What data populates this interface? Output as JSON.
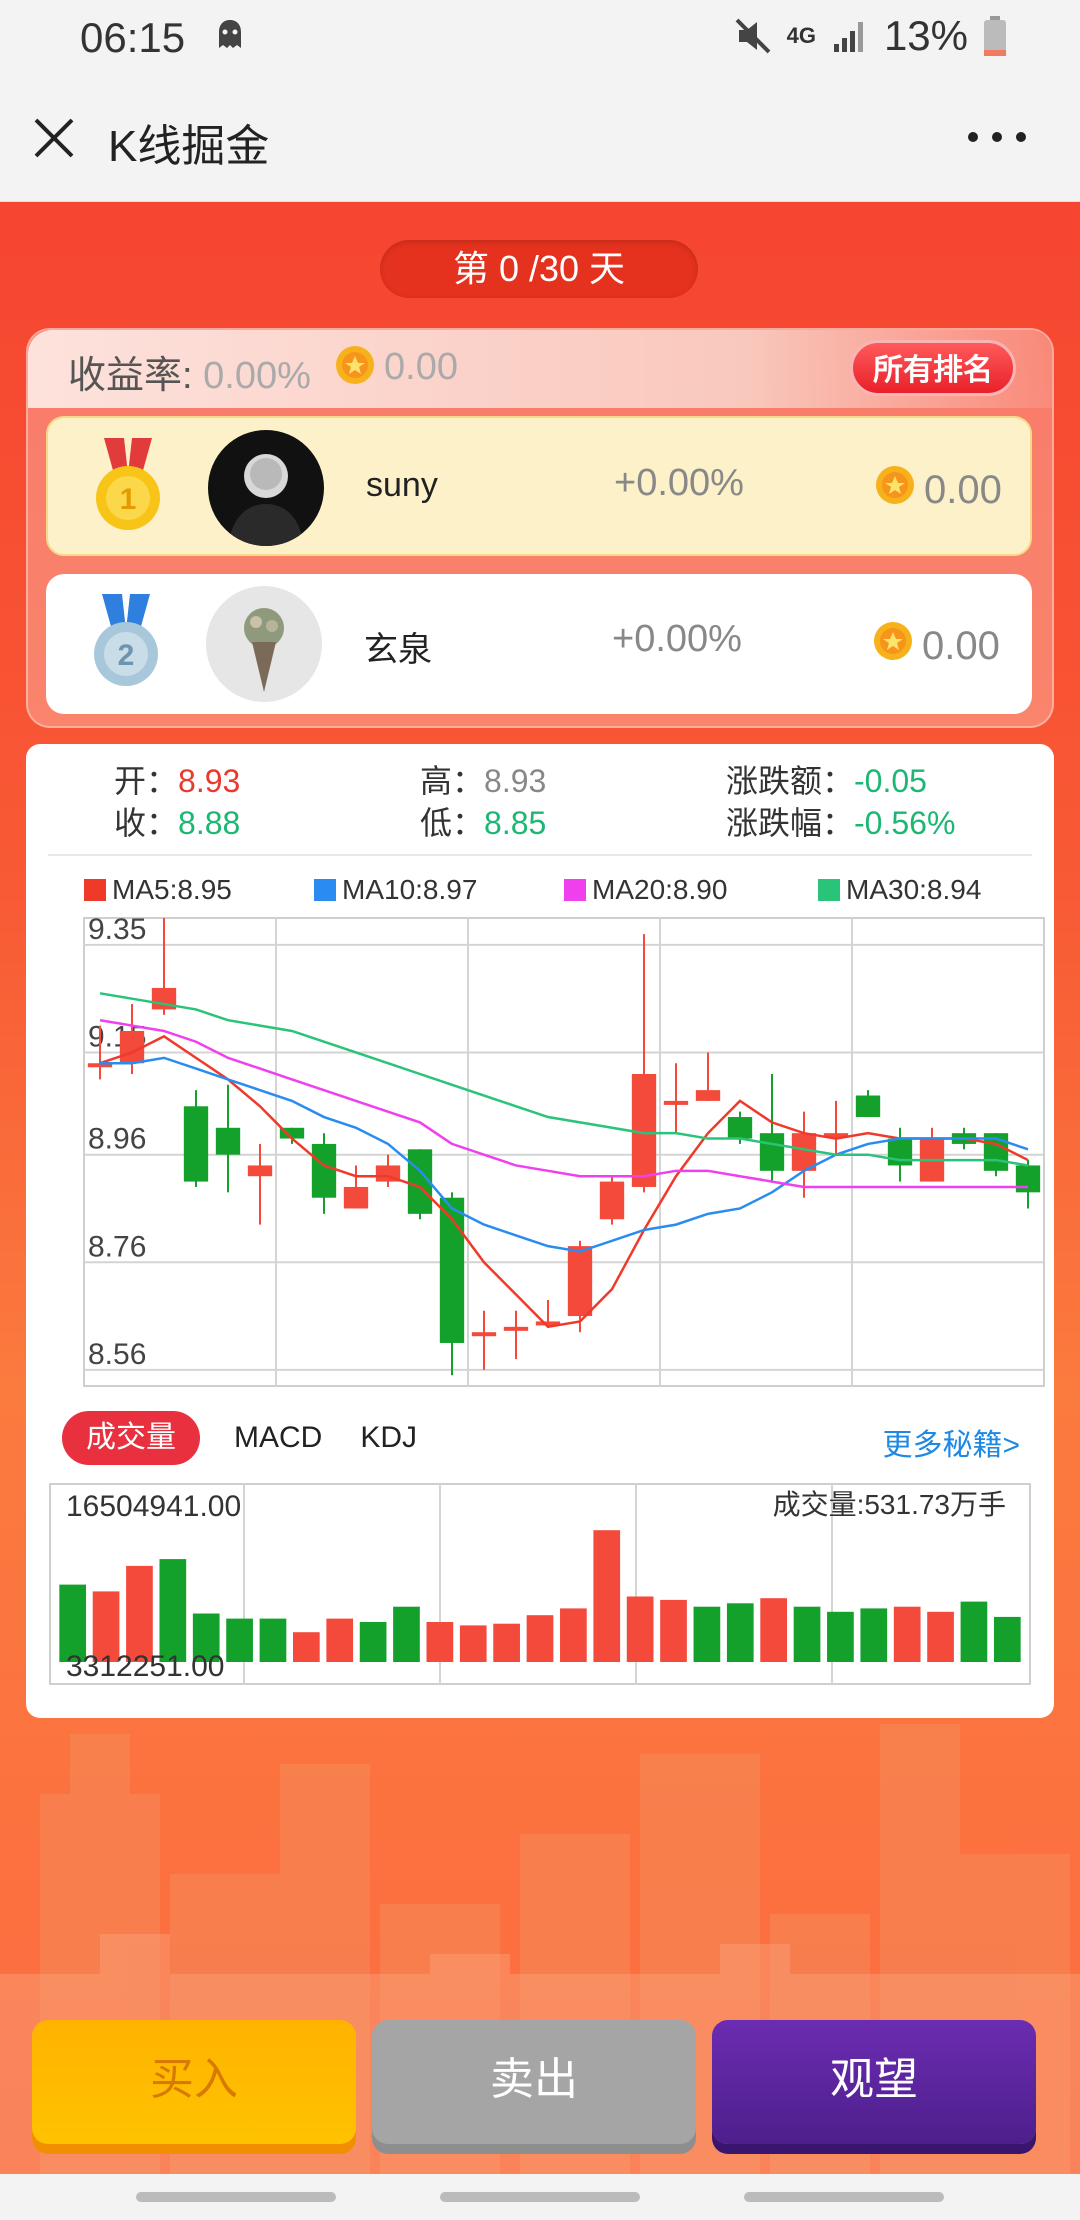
{
  "status_bar": {
    "time": "06:15",
    "network": "4G",
    "battery": "13%",
    "icons": [
      "ghost-icon",
      "mute-icon",
      "signal-icon",
      "battery-icon"
    ]
  },
  "title_bar": {
    "title": "K线掘金",
    "close_icon": "close-icon",
    "more_icon": "more-icon"
  },
  "day_counter": "第 0 /30 天",
  "summary": {
    "yield_label": "收益率:",
    "yield_value": "0.00%",
    "coin_value": "0.00",
    "all_rank_label": "所有排名"
  },
  "rankings": [
    {
      "rank": "1",
      "name": "suny",
      "pct": "+0.00%",
      "coins": "0.00"
    },
    {
      "rank": "2",
      "name": "玄泉",
      "pct": "+0.00%",
      "coins": "0.00"
    }
  ],
  "ohlc": {
    "open_label": "开：",
    "open": "8.93",
    "high_label": "高：",
    "high": "8.93",
    "change_label": "涨跌额：",
    "change": "-0.05",
    "close_label": "收：",
    "close": "8.88",
    "low_label": "低：",
    "low": "8.85",
    "change_pct_label": "涨跌幅：",
    "change_pct": "-0.56%"
  },
  "ma_legend": [
    {
      "label": "MA5:8.95",
      "color": "#ef3a2a"
    },
    {
      "label": "MA10:8.97",
      "color": "#2a8cf0"
    },
    {
      "label": "MA20:8.90",
      "color": "#f040ee"
    },
    {
      "label": "MA30:8.94",
      "color": "#2ac37a"
    }
  ],
  "tabs": {
    "active": "成交量",
    "items": [
      "MACD",
      "KDJ"
    ],
    "more": "更多秘籍>"
  },
  "volume_panel": {
    "max_label": "16504941.00",
    "min_label": "3312251.00",
    "current_label": "成交量:531.73万手"
  },
  "actions": {
    "buy": "买入",
    "sell": "卖出",
    "watch": "观望"
  },
  "colors": {
    "up": "#f34a3c",
    "down": "#13a12c",
    "accent_red": "#e8303f",
    "link_blue": "#1e88e5"
  },
  "chart_data": [
    {
      "type": "candlestick",
      "y_ticks": [
        "9.35",
        "9.15",
        "8.96",
        "8.76",
        "8.56"
      ],
      "ylim": [
        8.53,
        9.4
      ],
      "candles": [
        {
          "o": 9.13,
          "c": 9.13,
          "h": 9.2,
          "l": 9.1
        },
        {
          "o": 9.13,
          "c": 9.19,
          "h": 9.24,
          "l": 9.11
        },
        {
          "o": 9.23,
          "c": 9.27,
          "h": 9.4,
          "l": 9.22
        },
        {
          "o": 9.05,
          "c": 8.91,
          "h": 9.08,
          "l": 8.9
        },
        {
          "o": 9.01,
          "c": 8.96,
          "h": 9.09,
          "l": 8.89
        },
        {
          "o": 8.92,
          "c": 8.94,
          "h": 8.98,
          "l": 8.83
        },
        {
          "o": 9.01,
          "c": 8.99,
          "h": 9.01,
          "l": 8.98
        },
        {
          "o": 8.98,
          "c": 8.88,
          "h": 9.0,
          "l": 8.85
        },
        {
          "o": 8.86,
          "c": 8.9,
          "h": 8.94,
          "l": 8.86
        },
        {
          "o": 8.91,
          "c": 8.94,
          "h": 8.96,
          "l": 8.9
        },
        {
          "o": 8.97,
          "c": 8.85,
          "h": 8.97,
          "l": 8.84
        },
        {
          "o": 8.88,
          "c": 8.61,
          "h": 8.89,
          "l": 8.55
        },
        {
          "o": 8.63,
          "c": 8.63,
          "h": 8.67,
          "l": 8.56
        },
        {
          "o": 8.64,
          "c": 8.64,
          "h": 8.67,
          "l": 8.58
        },
        {
          "o": 8.65,
          "c": 8.65,
          "h": 8.69,
          "l": 8.64
        },
        {
          "o": 8.66,
          "c": 8.79,
          "h": 8.8,
          "l": 8.63
        },
        {
          "o": 8.84,
          "c": 8.91,
          "h": 8.92,
          "l": 8.83
        },
        {
          "o": 8.9,
          "c": 9.11,
          "h": 9.37,
          "l": 8.89
        },
        {
          "o": 9.06,
          "c": 9.06,
          "h": 9.13,
          "l": 9.0
        },
        {
          "o": 9.06,
          "c": 9.08,
          "h": 9.15,
          "l": 9.06
        },
        {
          "o": 9.03,
          "c": 8.99,
          "h": 9.04,
          "l": 8.98
        },
        {
          "o": 9.0,
          "c": 8.93,
          "h": 9.11,
          "l": 8.91
        },
        {
          "o": 8.93,
          "c": 9.0,
          "h": 9.04,
          "l": 8.88
        },
        {
          "o": 9.0,
          "c": 9.0,
          "h": 9.06,
          "l": 8.96
        },
        {
          "o": 9.07,
          "c": 9.03,
          "h": 9.08,
          "l": 9.03
        },
        {
          "o": 8.99,
          "c": 8.94,
          "h": 9.01,
          "l": 8.91
        },
        {
          "o": 8.91,
          "c": 8.99,
          "h": 9.01,
          "l": 8.91
        },
        {
          "o": 9.0,
          "c": 8.98,
          "h": 9.01,
          "l": 8.97
        },
        {
          "o": 9.0,
          "c": 8.93,
          "h": 9.0,
          "l": 8.92
        },
        {
          "o": 8.94,
          "c": 8.89,
          "h": 8.95,
          "l": 8.86
        }
      ],
      "ma": {
        "MA5": [
          9.13,
          9.15,
          9.18,
          9.14,
          9.1,
          9.05,
          8.99,
          8.94,
          8.92,
          8.92,
          8.9,
          8.84,
          8.76,
          8.7,
          8.64,
          8.65,
          8.71,
          8.82,
          8.92,
          9.0,
          9.06,
          9.02,
          9.0,
          8.99,
          9.0,
          8.99,
          8.99,
          8.99,
          8.98,
          8.95
        ],
        "MA10": [
          9.13,
          9.13,
          9.14,
          9.12,
          9.1,
          9.08,
          9.06,
          9.03,
          9.01,
          8.98,
          8.93,
          8.86,
          8.83,
          8.81,
          8.79,
          8.78,
          8.8,
          8.82,
          8.83,
          8.85,
          8.86,
          8.89,
          8.93,
          8.96,
          8.98,
          8.99,
          8.99,
          8.99,
          8.99,
          8.97
        ],
        "MA20": [
          9.21,
          9.2,
          9.19,
          9.17,
          9.14,
          9.12,
          9.1,
          9.08,
          9.06,
          9.04,
          9.02,
          8.98,
          8.96,
          8.94,
          8.93,
          8.92,
          8.92,
          8.92,
          8.93,
          8.93,
          8.92,
          8.91,
          8.9,
          8.9,
          8.9,
          8.9,
          8.9,
          8.9,
          8.9,
          8.9
        ],
        "MA30": [
          9.26,
          9.25,
          9.24,
          9.23,
          9.21,
          9.2,
          9.19,
          9.17,
          9.15,
          9.13,
          9.11,
          9.09,
          9.07,
          9.05,
          9.03,
          9.02,
          9.01,
          9.0,
          9.0,
          8.99,
          8.99,
          8.98,
          8.97,
          8.96,
          8.96,
          8.95,
          8.95,
          8.95,
          8.95,
          8.94
        ]
      }
    },
    {
      "type": "bar",
      "ylim": [
        3312251,
        16504941
      ],
      "volumes": [
        {
          "v": 0.42,
          "up": false
        },
        {
          "v": 0.38,
          "up": true
        },
        {
          "v": 0.53,
          "up": true
        },
        {
          "v": 0.57,
          "up": false
        },
        {
          "v": 0.25,
          "up": false
        },
        {
          "v": 0.22,
          "up": false
        },
        {
          "v": 0.22,
          "up": false
        },
        {
          "v": 0.14,
          "up": true
        },
        {
          "v": 0.22,
          "up": true
        },
        {
          "v": 0.2,
          "up": false
        },
        {
          "v": 0.29,
          "up": false
        },
        {
          "v": 0.2,
          "up": true
        },
        {
          "v": 0.18,
          "up": true
        },
        {
          "v": 0.19,
          "up": true
        },
        {
          "v": 0.24,
          "up": true
        },
        {
          "v": 0.28,
          "up": true
        },
        {
          "v": 0.74,
          "up": true
        },
        {
          "v": 0.35,
          "up": true
        },
        {
          "v": 0.33,
          "up": true
        },
        {
          "v": 0.29,
          "up": false
        },
        {
          "v": 0.31,
          "up": false
        },
        {
          "v": 0.34,
          "up": true
        },
        {
          "v": 0.29,
          "up": false
        },
        {
          "v": 0.26,
          "up": false
        },
        {
          "v": 0.28,
          "up": false
        },
        {
          "v": 0.29,
          "up": true
        },
        {
          "v": 0.26,
          "up": true
        },
        {
          "v": 0.32,
          "up": false
        },
        {
          "v": 0.23,
          "up": false
        }
      ]
    }
  ]
}
